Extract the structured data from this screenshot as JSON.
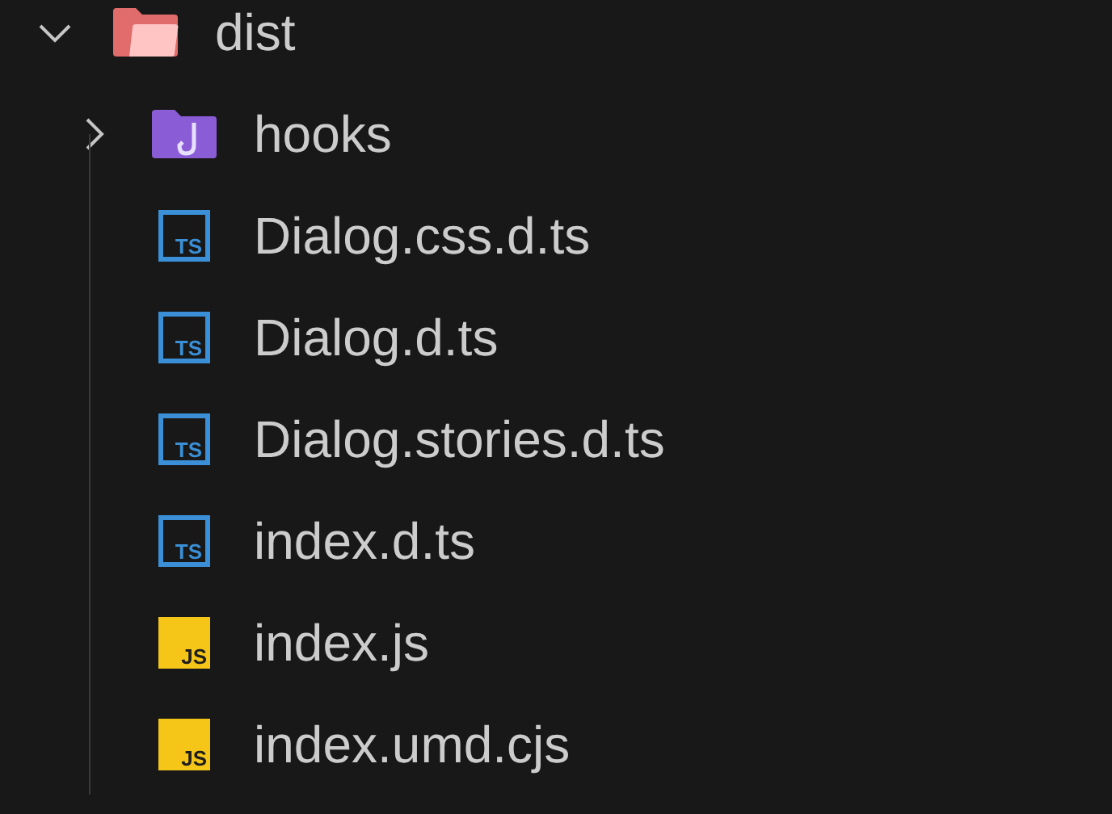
{
  "tree": [
    {
      "name": "dist",
      "kind": "folder",
      "color": "#e06c6c",
      "expanded": true,
      "children": [
        {
          "name": "hooks",
          "kind": "hook-folder",
          "color": "#8a5cd6",
          "expanded": false
        },
        {
          "name": "Dialog.css.d.ts",
          "kind": "ts",
          "icon_text": "TS"
        },
        {
          "name": "Dialog.d.ts",
          "kind": "ts",
          "icon_text": "TS"
        },
        {
          "name": "Dialog.stories.d.ts",
          "kind": "ts",
          "icon_text": "TS"
        },
        {
          "name": "index.d.ts",
          "kind": "ts",
          "icon_text": "TS"
        },
        {
          "name": "index.js",
          "kind": "js",
          "icon_text": "JS"
        },
        {
          "name": "index.umd.cjs",
          "kind": "js",
          "icon_text": "JS"
        }
      ]
    }
  ]
}
